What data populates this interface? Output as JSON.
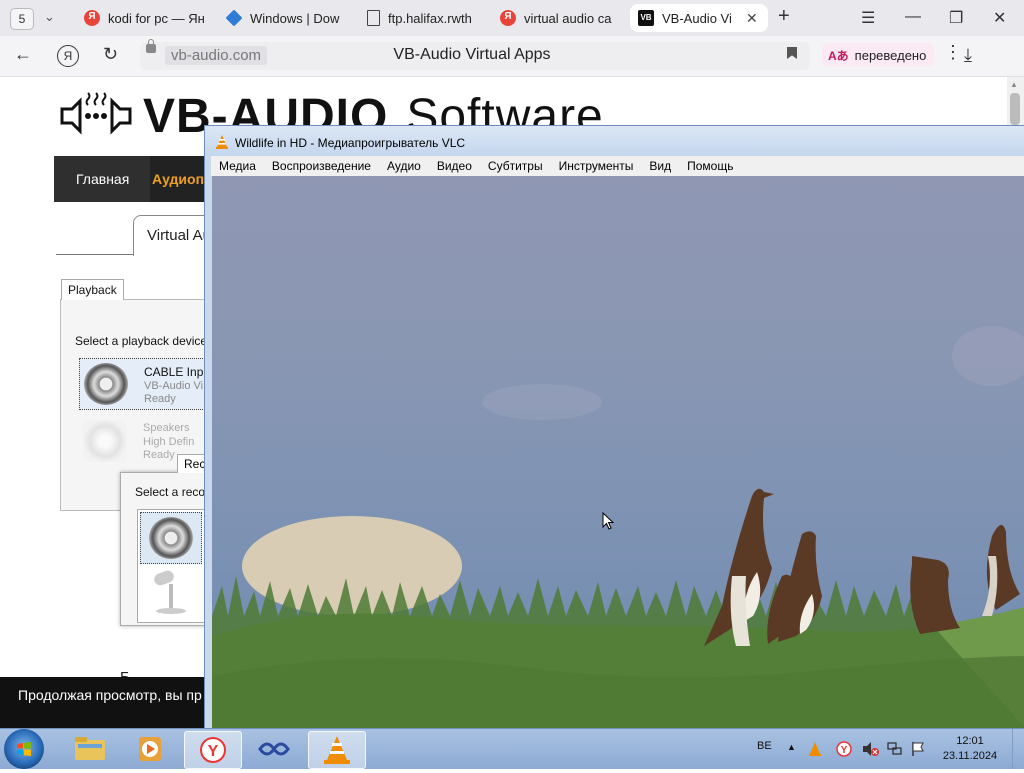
{
  "browser": {
    "tab_count": "5",
    "tabs": [
      {
        "title": "kodi for pc — Ян"
      },
      {
        "title": "Windows | Dow"
      },
      {
        "title": "ftp.halifax.rwth"
      },
      {
        "title": "virtual audio ca"
      },
      {
        "title": "VB-Audio Vi"
      }
    ],
    "address": {
      "domain": "vb-audio.com",
      "page_title": "VB-Audio Virtual Apps",
      "translated_label": "переведено"
    }
  },
  "page": {
    "logo_text": "VB-AUDIO",
    "logo_software": "Software",
    "nav": {
      "home": "Главная",
      "active": "Аудиопр"
    },
    "subtab": "Virtual Au",
    "sound_dialog": {
      "tab": "Playback",
      "instruction": "Select a playback device b",
      "devices": [
        {
          "name": "CABLE Input",
          "sub1": "VB-Audio Vi",
          "sub2": "Ready"
        },
        {
          "name": "Speakers",
          "sub1": "High Defin",
          "sub2": "Ready"
        }
      ]
    },
    "record_dialog": {
      "tab": "Reco",
      "instruction": "Select a reco"
    },
    "footnote": "Б",
    "banner": "Продолжая просмотр, вы пр"
  },
  "vlc": {
    "title": "Wildlife in HD - Медиапроигрыватель VLC",
    "menu": [
      "Медиа",
      "Воспроизведение",
      "Аудио",
      "Видео",
      "Субтитры",
      "Инструменты",
      "Вид",
      "Помощь"
    ]
  },
  "taskbar": {
    "language": "BE",
    "time": "12:01",
    "date": "23.11.2024"
  },
  "colors": {
    "vlc_orange": "#f08c00",
    "nav_active": "#f0a020",
    "translate_accent": "#c2185b"
  }
}
